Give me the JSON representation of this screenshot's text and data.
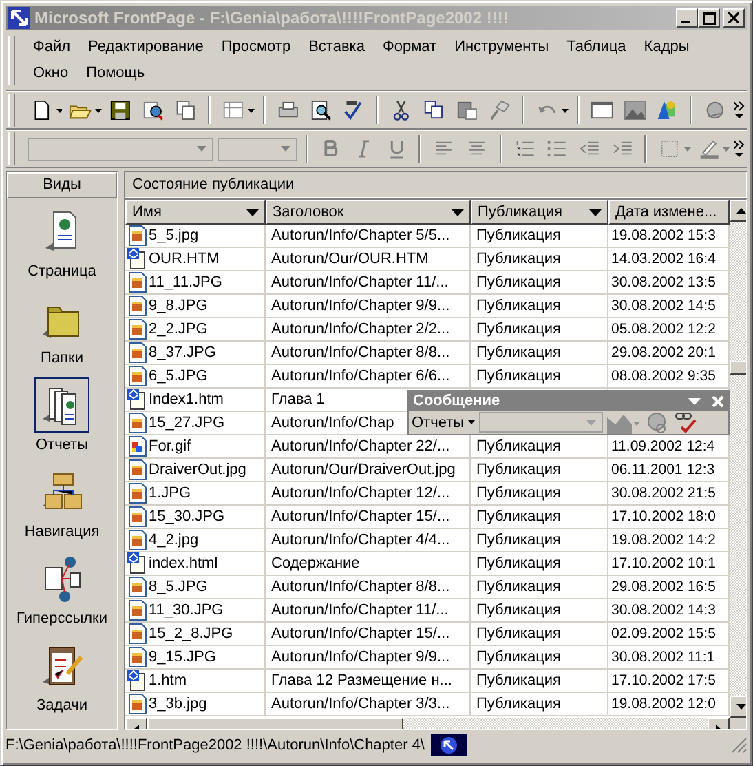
{
  "window": {
    "title": "Microsoft FrontPage - F:\\Genia\\работа\\!!!!FrontPage2002 !!!!",
    "active": false
  },
  "menu": [
    "Файл",
    "Редактирование",
    "Просмотр",
    "Вставка",
    "Формат",
    "Инструменты",
    "Таблица",
    "Кадры",
    "Окно",
    "Помощь"
  ],
  "views": {
    "title": "Виды",
    "items": [
      {
        "label": "Страница",
        "kind": "page",
        "selected": false
      },
      {
        "label": "Папки",
        "kind": "folders",
        "selected": false
      },
      {
        "label": "Отчеты",
        "kind": "reports",
        "selected": true
      },
      {
        "label": "Навигация",
        "kind": "navigation",
        "selected": false
      },
      {
        "label": "Гиперссылки",
        "kind": "hyperlinks",
        "selected": false
      },
      {
        "label": "Задачи",
        "kind": "tasks",
        "selected": false
      }
    ]
  },
  "report": {
    "title": "Состояние публикации",
    "columns": [
      "Имя",
      "Заголовок",
      "Публикация",
      "Дата измене..."
    ],
    "rows": [
      {
        "kind": "image",
        "name": "5_5.jpg",
        "title": "Autorun/Info/Chapter 5/5...",
        "publish": "Публикация",
        "date": "19.08.2002 15:3"
      },
      {
        "kind": "page",
        "name": "OUR.HTM",
        "title": "Autorun/Our/OUR.HTM",
        "publish": "Публикация",
        "date": "14.03.2002 16:4"
      },
      {
        "kind": "image",
        "name": "11_11.JPG",
        "title": "Autorun/Info/Chapter 11/...",
        "publish": "Публикация",
        "date": "30.08.2002 13:5"
      },
      {
        "kind": "image",
        "name": "9_8.JPG",
        "title": "Autorun/Info/Chapter 9/9...",
        "publish": "Публикация",
        "date": "30.08.2002 14:5"
      },
      {
        "kind": "image",
        "name": "2_2.JPG",
        "title": "Autorun/Info/Chapter 2/2...",
        "publish": "Публикация",
        "date": "05.08.2002 12:2"
      },
      {
        "kind": "image",
        "name": "8_37.JPG",
        "title": "Autorun/Info/Chapter 8/8...",
        "publish": "Публикация",
        "date": "29.08.2002 20:1"
      },
      {
        "kind": "image",
        "name": "6_5.JPG",
        "title": "Autorun/Info/Chapter 6/6...",
        "publish": "Публикация",
        "date": "08.08.2002 9:35"
      },
      {
        "kind": "page",
        "name": "Index1.htm",
        "title": "Глава 1"
      },
      {
        "kind": "image",
        "name": "15_27.JPG",
        "title": "Autorun/Info/Chap"
      },
      {
        "kind": "gif",
        "name": "For.gif",
        "title": "Autorun/Info/Chapter 22/...",
        "publish": "Публикация",
        "date": "11.09.2002 12:4"
      },
      {
        "kind": "image",
        "name": "DraiverOut.jpg",
        "title": "Autorun/Our/DraiverOut.jpg",
        "publish": "Публикация",
        "date": "06.11.2001 12:3"
      },
      {
        "kind": "image",
        "name": "1.JPG",
        "title": "Autorun/Info/Chapter 12/...",
        "publish": "Публикация",
        "date": "30.08.2002 21:5"
      },
      {
        "kind": "image",
        "name": "15_30.JPG",
        "title": "Autorun/Info/Chapter 15/...",
        "publish": "Публикация",
        "date": "17.10.2002 18:0"
      },
      {
        "kind": "image",
        "name": "4_2.jpg",
        "title": "Autorun/Info/Chapter 4/4...",
        "publish": "Публикация",
        "date": "19.08.2002 14:2"
      },
      {
        "kind": "page",
        "name": "index.html",
        "title": "Содержание",
        "publish": "Публикация",
        "date": "17.10.2002 10:1"
      },
      {
        "kind": "image",
        "name": "8_5.JPG",
        "title": "Autorun/Info/Chapter 8/8...",
        "publish": "Публикация",
        "date": "29.08.2002 16:5"
      },
      {
        "kind": "image",
        "name": "11_30.JPG",
        "title": "Autorun/Info/Chapter 11/...",
        "publish": "Публикация",
        "date": "30.08.2002 14:3"
      },
      {
        "kind": "image",
        "name": "15_2_8.JPG",
        "title": "Autorun/Info/Chapter 15/...",
        "publish": "Публикация",
        "date": "02.09.2002 15:5"
      },
      {
        "kind": "image",
        "name": "9_15.JPG",
        "title": "Autorun/Info/Chapter 9/9...",
        "publish": "Публикация",
        "date": "30.08.2002 11:1"
      },
      {
        "kind": "page",
        "name": "1.htm",
        "title": "Глава 12 Размещение н...",
        "publish": "Публикация",
        "date": "17.10.2002 17:5"
      },
      {
        "kind": "image",
        "name": "3_3b.jpg",
        "title": "Autorun/Info/Chapter 3/3...",
        "publish": "Публикация",
        "date": "19.08.2002 12:0"
      }
    ]
  },
  "floating_toolbar": {
    "title": "Сообщение",
    "button": "Отчеты"
  },
  "status_bar": {
    "path": "F:\\Genia\\работа\\!!!!FrontPage2002 !!!!\\Autorun\\Info\\Chapter 4\\"
  }
}
